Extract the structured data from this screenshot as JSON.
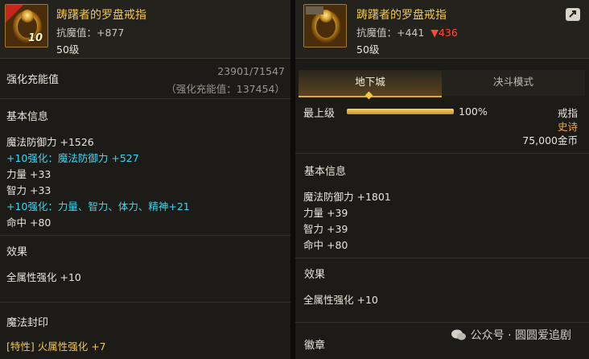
{
  "left": {
    "title": "踌躇者的罗盘戒指",
    "badge_text": "10",
    "resist": "抗魔值：+877",
    "level": "50级",
    "enhance_label": "强化充能值",
    "enhance_value": "23901/71547",
    "enhance_total": "（强化充能值：137454）",
    "basic_title": "基本信息",
    "stats": [
      "魔法防御力 +1526",
      "+10强化：魔法防御力 +527",
      "力量 +33",
      "智力 +33",
      "+10强化：力量、智力、体力、精神+21",
      "命中 +80"
    ],
    "effect_title": "效果",
    "effect_text": "全属性强化 +10",
    "seal_title": "魔法封印",
    "seal_text": "[特性] 火属性强化 +7"
  },
  "right": {
    "title": "踌躇者的罗盘戒指",
    "resist": "抗魔值：+441",
    "resist_diff": "▼436",
    "level": "50级",
    "tabs": [
      "地下城",
      "决斗模式"
    ],
    "grade_label": "最上级",
    "grade_percent": "100%",
    "grade_fill": 1.0,
    "item_type": "戒指",
    "rarity": "史诗",
    "price": "75,000金币",
    "basic_title": "基本信息",
    "stats": [
      "魔法防御力 +1801",
      "力量 +39",
      "智力 +39",
      "命中 +80"
    ],
    "effect_title": "效果",
    "effect_text": "全属性强化 +10",
    "emblem_title": "徽章"
  },
  "watermark": "公众号 · 圆圆爱追剧",
  "colors": {
    "gold": "#f2c64a",
    "cyan": "#3ad6f0",
    "red": "#ff4a3a",
    "rarity": "#f2a93a"
  }
}
